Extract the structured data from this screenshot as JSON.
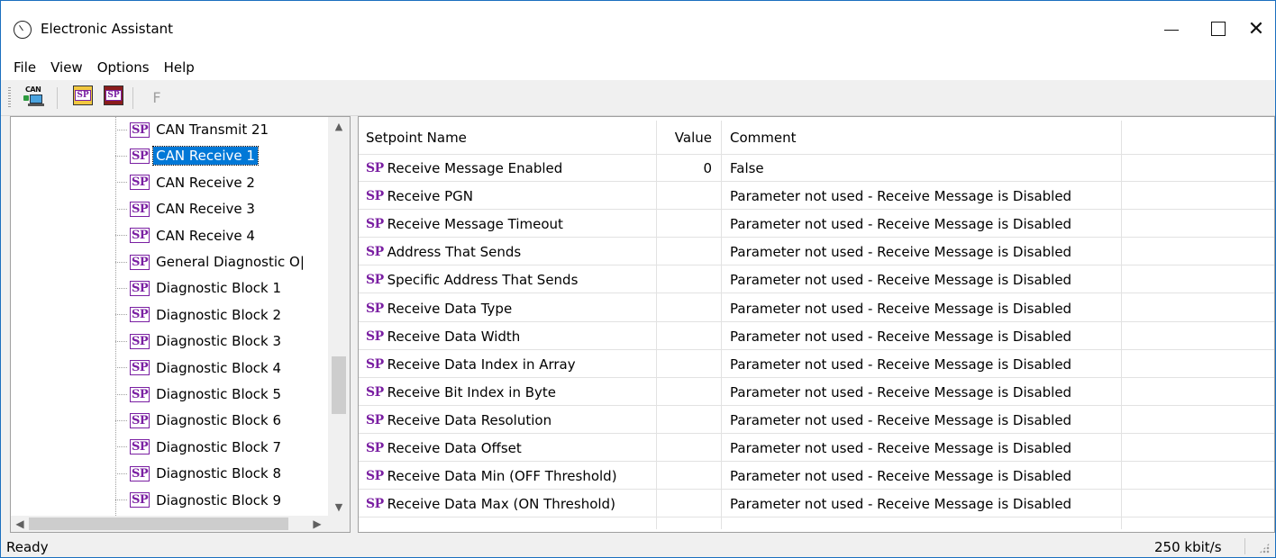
{
  "window": {
    "title": "Electronic Assistant"
  },
  "menu": {
    "items": [
      "File",
      "View",
      "Options",
      "Help"
    ]
  },
  "toolbar": {
    "can_label": "CAN",
    "sp_label": "SP",
    "f_label": "F"
  },
  "tree": {
    "badge": "SP",
    "items": [
      {
        "label": "CAN Transmit 21",
        "selected": false
      },
      {
        "label": "CAN Receive 1",
        "selected": true
      },
      {
        "label": "CAN Receive 2",
        "selected": false
      },
      {
        "label": "CAN Receive 3",
        "selected": false
      },
      {
        "label": "CAN Receive 4",
        "selected": false
      },
      {
        "label": "General Diagnostic O|",
        "selected": false
      },
      {
        "label": "Diagnostic Block 1",
        "selected": false
      },
      {
        "label": "Diagnostic Block 2",
        "selected": false
      },
      {
        "label": "Diagnostic Block 3",
        "selected": false
      },
      {
        "label": "Diagnostic Block 4",
        "selected": false
      },
      {
        "label": "Diagnostic Block 5",
        "selected": false
      },
      {
        "label": "Diagnostic Block 6",
        "selected": false
      },
      {
        "label": "Diagnostic Block 7",
        "selected": false
      },
      {
        "label": "Diagnostic Block 8",
        "selected": false
      },
      {
        "label": "Diagnostic Block 9",
        "selected": false
      }
    ]
  },
  "grid": {
    "headers": {
      "name": "Setpoint Name",
      "value": "Value",
      "comment": "Comment"
    },
    "badge": "SP",
    "rows": [
      {
        "name": "Receive Message Enabled",
        "value": "0",
        "comment": "False"
      },
      {
        "name": "Receive PGN",
        "value": "",
        "comment": "Parameter not used - Receive Message is Disabled"
      },
      {
        "name": "Receive Message Timeout",
        "value": "",
        "comment": "Parameter not used - Receive Message is Disabled"
      },
      {
        "name": "Address That Sends",
        "value": "",
        "comment": "Parameter not used - Receive Message is Disabled"
      },
      {
        "name": "Specific Address That Sends",
        "value": "",
        "comment": "Parameter not used - Receive Message is Disabled"
      },
      {
        "name": "Receive Data Type",
        "value": "",
        "comment": "Parameter not used - Receive Message is Disabled"
      },
      {
        "name": "Receive Data Width",
        "value": "",
        "comment": "Parameter not used - Receive Message is Disabled"
      },
      {
        "name": "Receive Data Index in Array",
        "value": "",
        "comment": "Parameter not used - Receive Message is Disabled"
      },
      {
        "name": "Receive Bit Index in Byte",
        "value": "",
        "comment": "Parameter not used - Receive Message is Disabled"
      },
      {
        "name": "Receive Data Resolution",
        "value": "",
        "comment": "Parameter not used - Receive Message is Disabled"
      },
      {
        "name": "Receive Data Offset",
        "value": "",
        "comment": "Parameter not used - Receive Message is Disabled"
      },
      {
        "name": "Receive Data Min (OFF Threshold)",
        "value": "",
        "comment": "Parameter not used - Receive Message is Disabled"
      },
      {
        "name": "Receive Data Max (ON Threshold)",
        "value": "",
        "comment": "Parameter not used - Receive Message is Disabled"
      }
    ]
  },
  "status": {
    "left": "Ready",
    "right": "250 kbit/s"
  }
}
